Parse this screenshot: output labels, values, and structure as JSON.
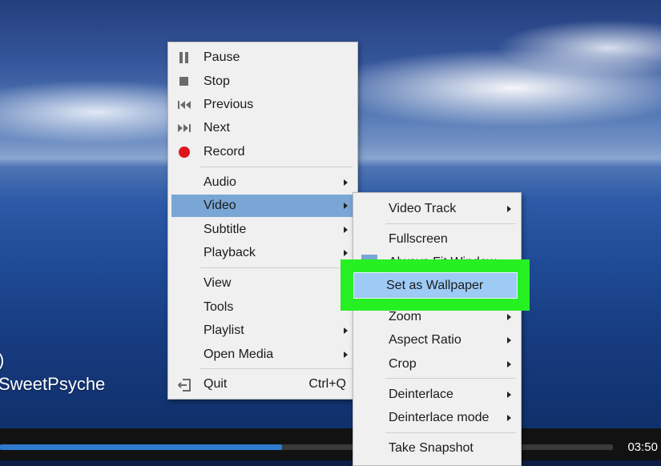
{
  "overlay": {
    "line1": ")",
    "line2": "SweetPsyche"
  },
  "player": {
    "time": "03:50",
    "progress_fraction": 0.46
  },
  "main_menu": {
    "items": [
      {
        "label": "Pause",
        "icon": "pause-icon"
      },
      {
        "label": "Stop",
        "icon": "stop-icon"
      },
      {
        "label": "Previous",
        "icon": "previous-icon"
      },
      {
        "label": "Next",
        "icon": "next-icon"
      },
      {
        "label": "Record",
        "icon": "record-icon",
        "icon_color": "#e0141e"
      },
      {
        "label": "Audio"
      },
      {
        "label": "Video"
      },
      {
        "label": "Subtitle"
      },
      {
        "label": "Playback"
      },
      {
        "label": "View"
      },
      {
        "label": "Tools"
      },
      {
        "label": "Playlist"
      },
      {
        "label": "Open Media"
      },
      {
        "label": "Quit",
        "icon": "quit-icon",
        "shortcut": "Ctrl+Q"
      }
    ]
  },
  "video_menu": {
    "items": [
      {
        "label": "Video Track"
      },
      {
        "label": "Fullscreen"
      },
      {
        "label": "Always Fit Window"
      },
      {
        "label": "Set as Wallpaper"
      },
      {
        "label": "Zoom"
      },
      {
        "label": "Aspect Ratio"
      },
      {
        "label": "Crop"
      },
      {
        "label": "Deinterlace"
      },
      {
        "label": "Deinterlace mode"
      },
      {
        "label": "Take Snapshot"
      }
    ]
  },
  "colors": {
    "menu_bg": "#f0f0f0",
    "selected_bg": "#7aa6d6",
    "highlight_box": "#27f022",
    "wallpaper_item_bg": "#9ecbf5",
    "seek_fill": "#2e7bd0"
  }
}
